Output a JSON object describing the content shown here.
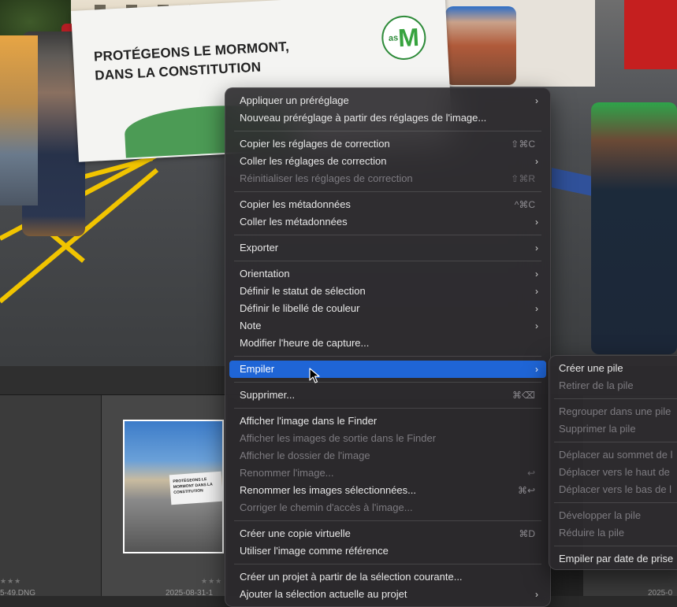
{
  "photo": {
    "banner_line1": "PROTÉGEONS LE MORMONT,",
    "banner_line2": "DANS LA CONSTITUTION",
    "logo_small": "as",
    "logo_big": "M"
  },
  "filmstrip": {
    "thumb_banner_text": "PROTÉGEONS LE MORMONT DANS LA CONSTITUTION",
    "file1": "5-49.DNG",
    "file2": "2025-08-31-1",
    "file3": "2025-0",
    "stars": "★★★"
  },
  "menu": {
    "apply_preset": "Appliquer un préréglage",
    "new_preset": "Nouveau préréglage à partir des réglages de l'image...",
    "copy_adjustments": "Copier les réglages de correction",
    "copy_adjustments_sc": "⇧⌘C",
    "paste_adjustments": "Coller les réglages de correction",
    "reset_adjustments": "Réinitialiser les réglages de correction",
    "reset_adjustments_sc": "⇧⌘R",
    "copy_metadata": "Copier les métadonnées",
    "copy_metadata_sc": "^⌘C",
    "paste_metadata": "Coller les métadonnées",
    "export": "Exporter",
    "orientation": "Orientation",
    "set_selection_status": "Définir le statut de sélection",
    "set_color_label": "Définir le libellé de couleur",
    "note": "Note",
    "modify_capture_time": "Modifier l'heure de capture...",
    "stack": "Empiler",
    "delete": "Supprimer...",
    "delete_sc": "⌘⌫",
    "show_in_finder": "Afficher l'image dans le Finder",
    "show_outputs_in_finder": "Afficher les images de sortie dans le Finder",
    "show_image_folder": "Afficher le dossier de l'image",
    "rename_image": "Renommer l'image...",
    "rename_image_sc": "↩",
    "rename_selected": "Renommer les images sélectionnées...",
    "rename_selected_sc": "⌘↩",
    "fix_path": "Corriger le chemin d'accès à l'image...",
    "create_virtual_copy": "Créer une copie virtuelle",
    "create_virtual_copy_sc": "⌘D",
    "use_as_reference": "Utiliser l'image comme référence",
    "create_project": "Créer un projet à partir de la sélection courante...",
    "add_to_project": "Ajouter la sélection actuelle au projet"
  },
  "submenu": {
    "create_stack": "Créer une pile",
    "remove_from_stack": "Retirer de la pile",
    "group_into_stack": "Regrouper dans une pile",
    "delete_stack": "Supprimer la pile",
    "move_to_top": "Déplacer au sommet de l",
    "move_up": "Déplacer vers le haut de",
    "move_down": "Déplacer vers le bas de l",
    "expand_stack": "Développer la pile",
    "collapse_stack": "Réduire la pile",
    "stack_by_date": "Empiler par date de prise"
  },
  "colors": {
    "accent": "#1f65d6",
    "menu_bg": "#2c2a2e"
  }
}
